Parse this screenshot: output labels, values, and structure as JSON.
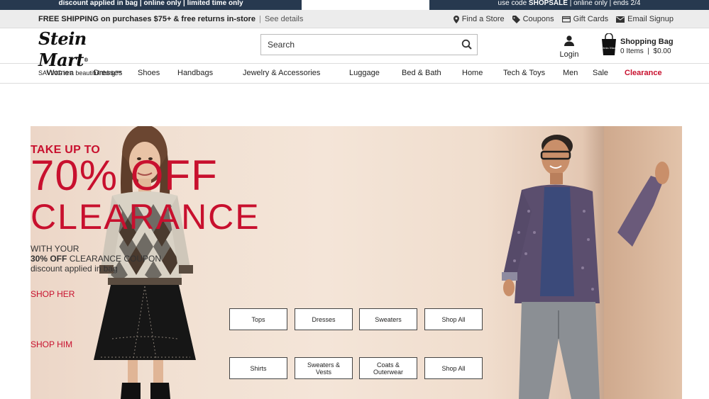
{
  "promo": {
    "left_text": "discount applied in bag | online only | limited time only",
    "right_pre": "use code ",
    "right_code": "SHOPSALE",
    "right_post": " | online only | ends 2/4"
  },
  "utility": {
    "shipping_bold": "FREE SHIPPING on purchases $75+ & free returns in-store",
    "separator": "|",
    "see_details": "See details",
    "links": [
      {
        "label": "Find a Store",
        "icon": "map-pin-icon"
      },
      {
        "label": "Coupons",
        "icon": "tag-icon"
      },
      {
        "label": "Gift Cards",
        "icon": "gift-card-icon"
      },
      {
        "label": "Email Signup",
        "icon": "envelope-icon"
      }
    ]
  },
  "header": {
    "logo_text": "Stein Mart",
    "logo_tagline": "SAVING is a beautiful thing™",
    "search_placeholder": "Search",
    "login_label": "Login",
    "bag_title": "Shopping Bag",
    "bag_items": "0 Items",
    "bag_total": "$0.00"
  },
  "nav": [
    "Women",
    "Dresses",
    "Shoes",
    "Handbags",
    "Jewelry & Accessories",
    "Luggage",
    "Bed & Bath",
    "Home",
    "Tech & Toys",
    "Men",
    "Sale",
    "Clearance"
  ],
  "hero": {
    "take_up": "TAKE UP TO",
    "pct_off": "70% OFF",
    "clearance": "CLEARANCE",
    "with_your": "WITH YOUR",
    "coupon_bold": "30% OFF",
    "coupon_rest": " CLEARANCE COUPON",
    "applied": "discount applied in bag",
    "shop_her": "SHOP HER",
    "shop_him": "SHOP HIM",
    "her_buttons": [
      "Tops",
      "Dresses",
      "Sweaters",
      "Shop All"
    ],
    "him_buttons": [
      "Shirts",
      "Sweaters & Vests",
      "Coats & Outerwear",
      "Shop All"
    ]
  },
  "colors": {
    "accent_red": "#c8102e",
    "promo_navy": "#27394f",
    "util_gray": "#ececec"
  }
}
